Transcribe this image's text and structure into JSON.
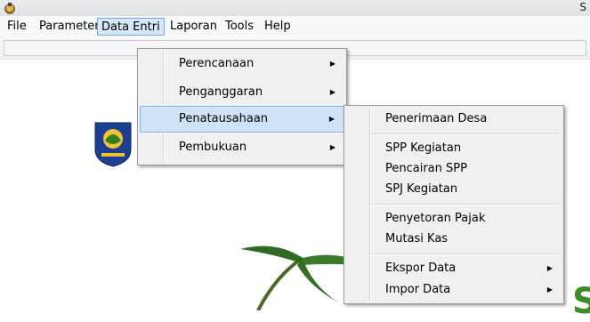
{
  "window": {
    "title_tail": "S"
  },
  "menubar": {
    "items": [
      {
        "label": "File"
      },
      {
        "label": "Parameter"
      },
      {
        "label": "Data Entri"
      },
      {
        "label": "Laporan"
      },
      {
        "label": "Tools"
      },
      {
        "label": "Help"
      }
    ],
    "active": "Data Entri"
  },
  "data_entri_menu": {
    "items": [
      {
        "label": "Perencanaan",
        "has_submenu": true
      },
      {
        "label": "Penganggaran",
        "has_submenu": true
      },
      {
        "label": "Penatausahaan",
        "has_submenu": true,
        "highlighted": true
      },
      {
        "label": "Pembukuan",
        "has_submenu": true
      }
    ]
  },
  "penatausahaan_submenu": {
    "groups": [
      [
        {
          "label": "Penerimaan Desa"
        }
      ],
      [
        {
          "label": "SPP Kegiatan"
        },
        {
          "label": "Pencairan SPP"
        },
        {
          "label": "SPJ Kegiatan"
        }
      ],
      [
        {
          "label": "Penyetoran Pajak"
        },
        {
          "label": "Mutasi Kas"
        }
      ],
      [
        {
          "label": "Ekspor Data",
          "has_submenu": true
        },
        {
          "label": "Impor Data",
          "has_submenu": true
        }
      ]
    ]
  },
  "background": {
    "partial_letter": "S"
  },
  "colors": {
    "menu_highlight": "#cfe3f7",
    "menu_highlight_border": "#8db6e0",
    "menu_bg": "#f0f0f0",
    "accent_green": "#3c8c2a"
  }
}
